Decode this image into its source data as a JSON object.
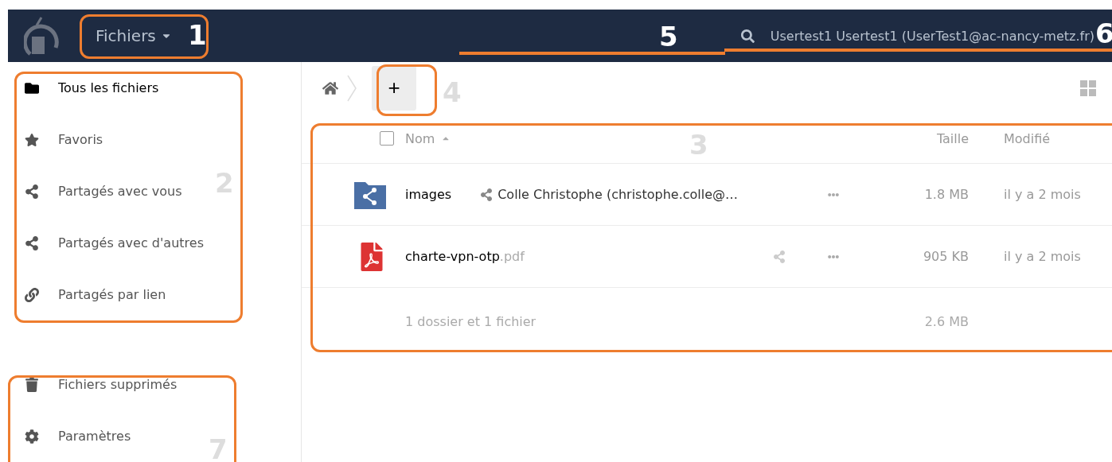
{
  "header": {
    "app_menu": "Fichiers",
    "user": "Usertest1 Usertest1 (UserTest1@ac-nancy-metz.fr)"
  },
  "sidebar": {
    "items": [
      {
        "label": "Tous les fichiers",
        "kind": "folder",
        "selected": true
      },
      {
        "label": "Favoris",
        "kind": "star",
        "selected": false
      },
      {
        "label": "Partagés avec vous",
        "kind": "share",
        "selected": false
      },
      {
        "label": "Partagés avec d'autres",
        "kind": "share",
        "selected": false
      },
      {
        "label": "Partagés par lien",
        "kind": "link",
        "selected": false
      }
    ],
    "bottom_items": [
      {
        "label": "Fichiers supprimés",
        "kind": "trash"
      },
      {
        "label": "Paramètres",
        "kind": "gear"
      }
    ]
  },
  "toolbar": {
    "new_button": "+"
  },
  "table": {
    "columns": [
      "Nom",
      "Taille",
      "Modifié"
    ],
    "select_all": {
      "checked": false
    },
    "rows": [
      {
        "kind": "shared-folder",
        "name": "images",
        "extension": "",
        "shared_with": "Colle Christophe (christophe.colle@…",
        "size": "1.8 MB",
        "modified": "il y a 2 mois"
      },
      {
        "kind": "pdf",
        "name": "charte-vpn-otp",
        "extension": ".pdf",
        "shared_with": "",
        "size": "905 KB",
        "modified": "il y a 2 mois"
      }
    ],
    "summary": {
      "text": "1 dossier et 1 fichier",
      "size": "2.6 MB"
    }
  },
  "annotations": [
    "1",
    "2",
    "3",
    "4",
    "5",
    "6",
    "7"
  ]
}
